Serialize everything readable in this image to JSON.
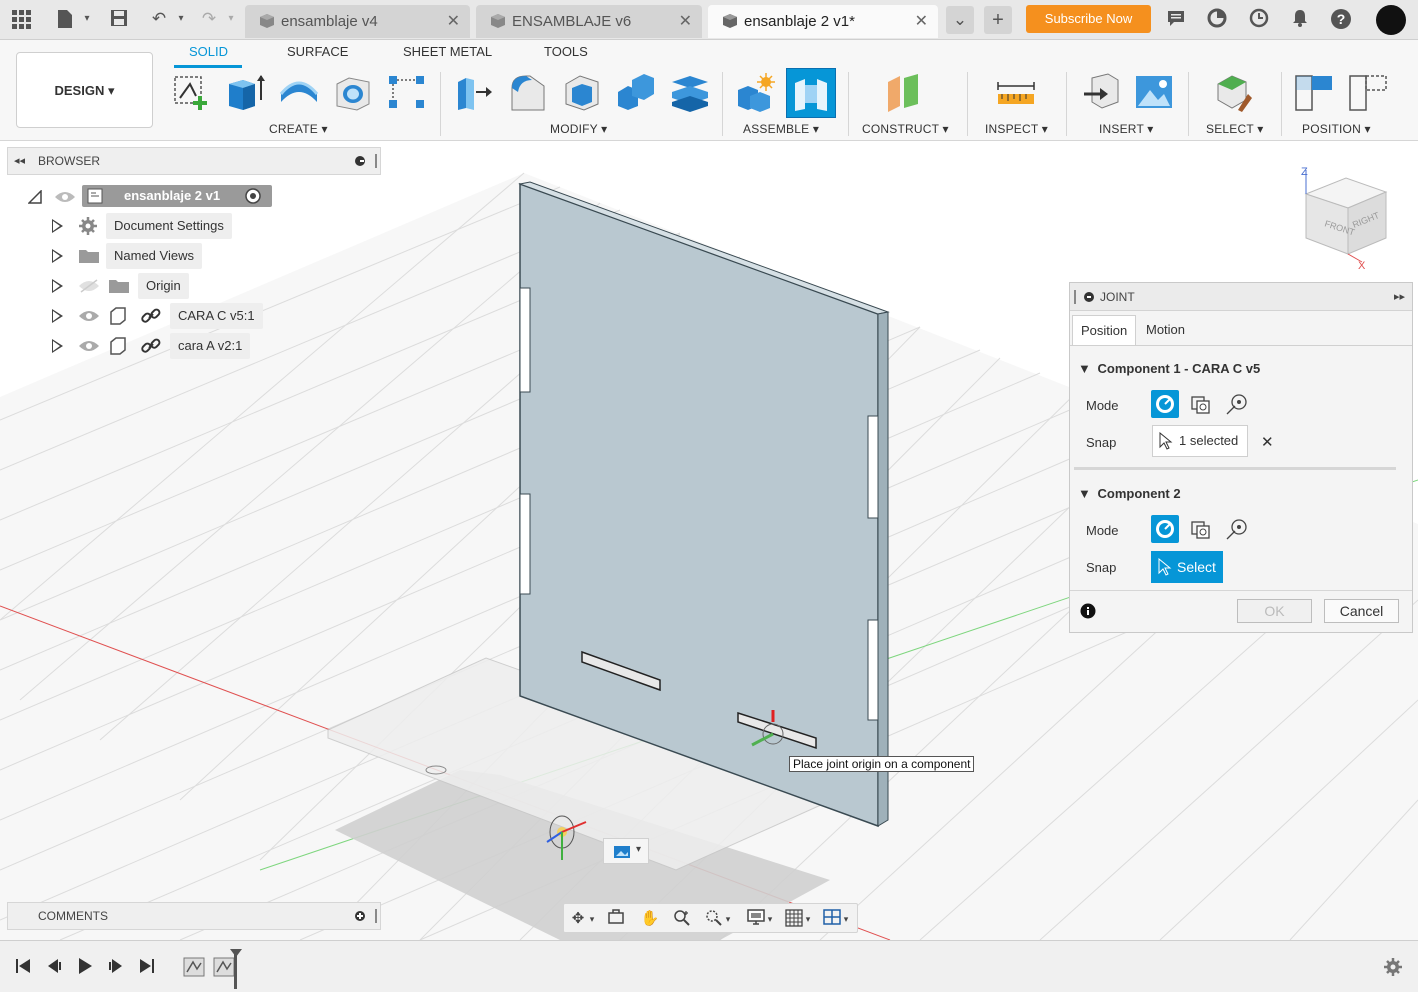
{
  "tabs": [
    {
      "label": "ensamblaje v4"
    },
    {
      "label": "ENSAMBLAJE v6"
    },
    {
      "label": "ensanblaje 2 v1*"
    }
  ],
  "subscribe_label": "Subscribe Now",
  "workspace_label": "DESIGN ▾",
  "ribbon_tabs": [
    "SOLID",
    "SURFACE",
    "SHEET METAL",
    "TOOLS"
  ],
  "ribbon_groups": [
    "CREATE ▾",
    "MODIFY ▾",
    "ASSEMBLE ▾",
    "CONSTRUCT ▾",
    "INSPECT ▾",
    "INSERT ▾",
    "SELECT ▾",
    "POSITION ▾"
  ],
  "browser": {
    "title": "BROWSER",
    "root": "ensanblaje 2 v1",
    "items": [
      "Document Settings",
      "Named Views",
      "Origin",
      "CARA C v5:1",
      "cara A v2:1"
    ]
  },
  "joint": {
    "title": "JOINT",
    "tabs": [
      "Position",
      "Motion"
    ],
    "component1": "Component 1 - CARA C v5",
    "component2": "Component 2",
    "mode_label": "Mode",
    "snap_label": "Snap",
    "selected_text": "1 selected",
    "select_text": "Select",
    "ok_label": "OK",
    "cancel_label": "Cancel"
  },
  "tooltip": "Place joint origin on a component",
  "comments_title": "COMMENTS",
  "viewcube": {
    "front": "FRONT",
    "right": "RIGHT",
    "z": "Z",
    "x": "X"
  },
  "colors": {
    "accent": "#0696d7",
    "subscribe": "#f5901e",
    "axis_red": "#e05050",
    "axis_green": "#60c060",
    "panel_fill": "#b9c8d0"
  }
}
